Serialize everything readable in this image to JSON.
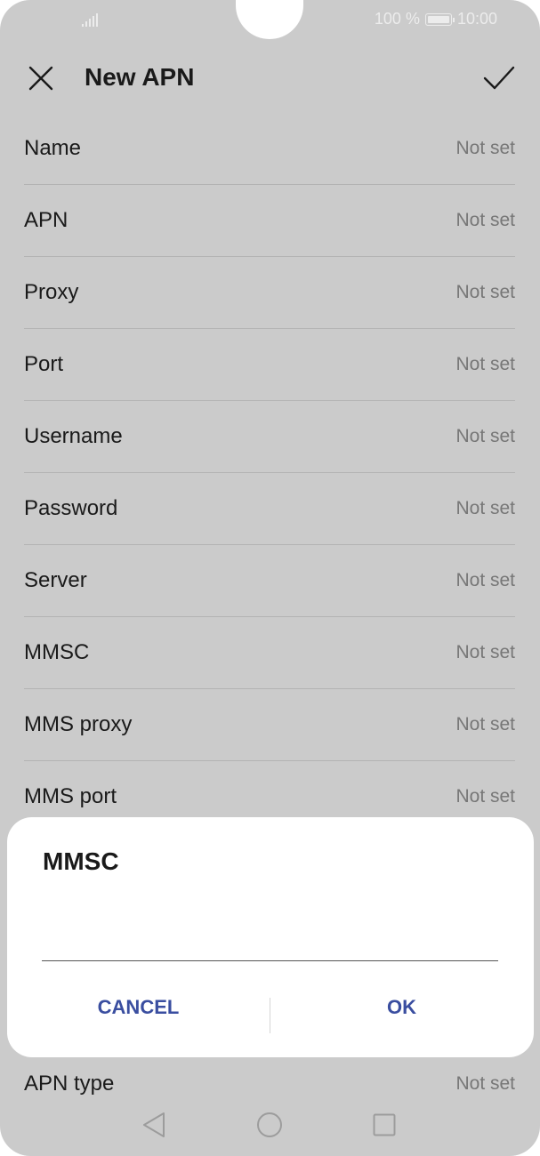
{
  "status_bar": {
    "battery_text": "100 %",
    "time": "10:00",
    "battery_level": 1.0
  },
  "toolbar": {
    "title": "New APN",
    "close_icon": "close-icon",
    "confirm_icon": "check-icon"
  },
  "settings": [
    {
      "label": "Name",
      "value": "Not set"
    },
    {
      "label": "APN",
      "value": "Not set"
    },
    {
      "label": "Proxy",
      "value": "Not set"
    },
    {
      "label": "Port",
      "value": "Not set"
    },
    {
      "label": "Username",
      "value": "Not set"
    },
    {
      "label": "Password",
      "value": "Not set"
    },
    {
      "label": "Server",
      "value": "Not set"
    },
    {
      "label": "MMSC",
      "value": "Not set"
    },
    {
      "label": "MMS proxy",
      "value": "Not set"
    },
    {
      "label": "MMS port",
      "value": "Not set"
    },
    {
      "label": "APN type",
      "value": "Not set"
    }
  ],
  "dialog": {
    "title": "MMSC",
    "input_value": "",
    "cancel_label": "CANCEL",
    "ok_label": "OK",
    "accent_color": "#3a4ea0"
  },
  "nav_bar": {
    "back_icon": "back-triangle-icon",
    "home_icon": "home-circle-icon",
    "recent_icon": "recent-square-icon"
  }
}
